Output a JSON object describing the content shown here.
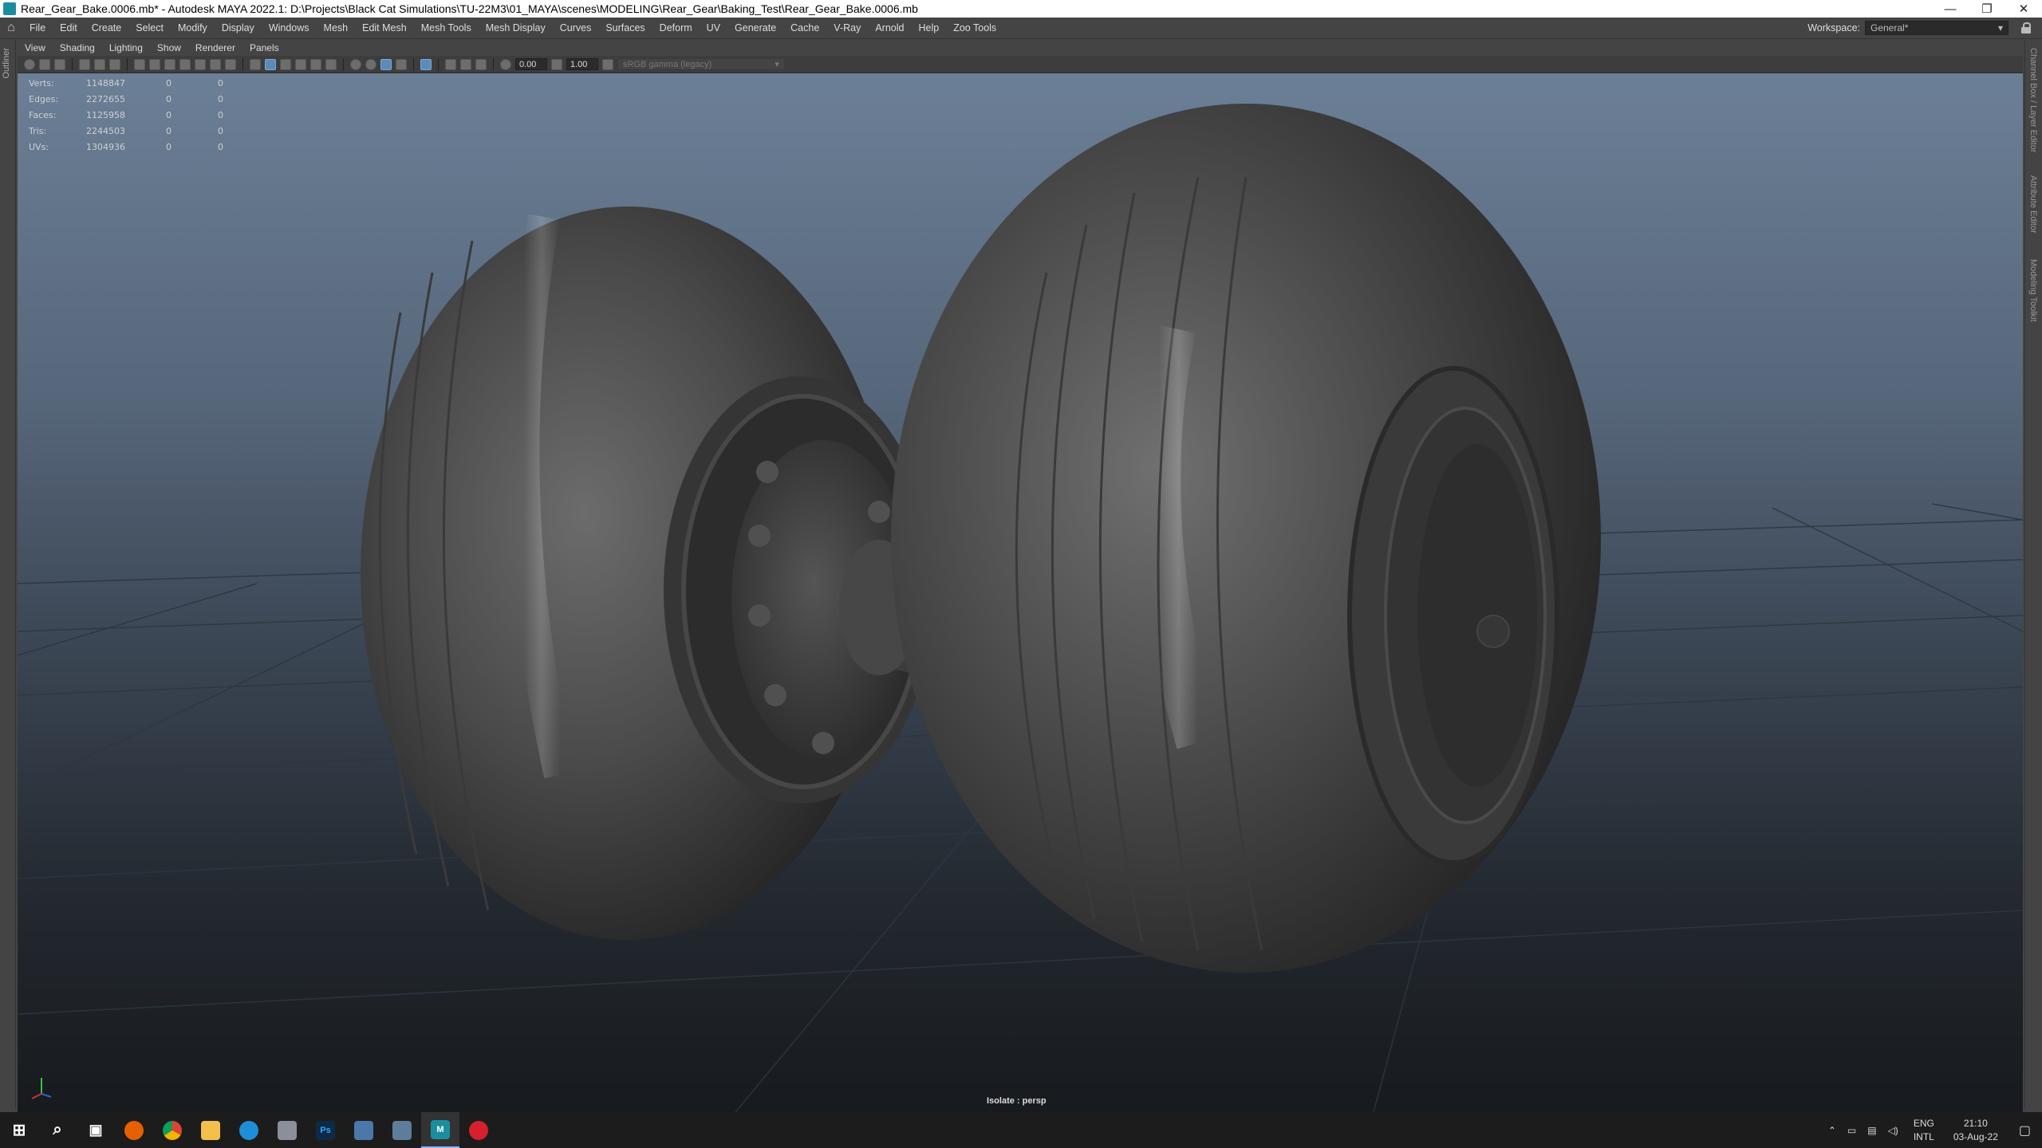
{
  "window": {
    "title": "Rear_Gear_Bake.0006.mb* - Autodesk MAYA 2022.1: D:\\Projects\\Black Cat Simulations\\TU-22M3\\01_MAYA\\scenes\\MODELING\\Rear_Gear\\Baking_Test\\Rear_Gear_Bake.0006.mb",
    "minimize": "—",
    "restore": "❐",
    "close": "✕"
  },
  "menubar": {
    "items": [
      "File",
      "Edit",
      "Create",
      "Select",
      "Modify",
      "Display",
      "Windows",
      "Mesh",
      "Edit Mesh",
      "Mesh Tools",
      "Mesh Display",
      "Curves",
      "Surfaces",
      "Deform",
      "UV",
      "Generate",
      "Cache",
      "V-Ray",
      "Arnold",
      "Help",
      "Zoo Tools"
    ],
    "workspace_label": "Workspace:",
    "workspace_value": "General*"
  },
  "left_tabs": {
    "outliner": "Outliner"
  },
  "right_tabs": [
    "Channel Box / Layer Editor",
    "Attribute Editor",
    "Modeling Toolkit"
  ],
  "panel_menu": [
    "View",
    "Shading",
    "Lighting",
    "Show",
    "Renderer",
    "Panels"
  ],
  "panel_toolbar": {
    "value_a": "0.00",
    "value_b": "1.00",
    "color_space": "sRGB gamma (legacy)"
  },
  "hud": {
    "rows": [
      {
        "label": "Verts:",
        "total": "1148847",
        "selected": "0",
        "third": "0"
      },
      {
        "label": "Edges:",
        "total": "2272655",
        "selected": "0",
        "third": "0"
      },
      {
        "label": "Faces:",
        "total": "1125958",
        "selected": "0",
        "third": "0"
      },
      {
        "label": "Tris:",
        "total": "2244503",
        "selected": "0",
        "third": "0"
      },
      {
        "label": "UVs:",
        "total": "1304936",
        "selected": "0",
        "third": "0"
      }
    ]
  },
  "viewport": {
    "camera_label": "Isolate : persp"
  },
  "taskbar": {
    "apps": [
      {
        "name": "start-icon",
        "glyph": "⊞",
        "color": "#1c1c1c"
      },
      {
        "name": "search-icon",
        "glyph": "⌕",
        "color": "#1c1c1c"
      },
      {
        "name": "task-view-icon",
        "glyph": "▣",
        "color": "#1c1c1c"
      },
      {
        "name": "firefox-icon",
        "glyph": "",
        "color": "#e66000"
      },
      {
        "name": "chrome-icon",
        "glyph": "",
        "color": "#db4437"
      },
      {
        "name": "file-explorer-icon",
        "glyph": "",
        "color": "#f2c04b"
      },
      {
        "name": "edge-icon",
        "glyph": "",
        "color": "#1e8fd6"
      },
      {
        "name": "cloud-app-icon",
        "glyph": "",
        "color": "#8a8f99"
      },
      {
        "name": "photoshop-icon",
        "glyph": "Ps",
        "color": "#0d2a47"
      },
      {
        "name": "window-app-icon",
        "glyph": "",
        "color": "#4a78a8"
      },
      {
        "name": "notepad-icon",
        "glyph": "",
        "color": "#5d7d9a"
      },
      {
        "name": "maya-icon",
        "glyph": "M",
        "color": "#1b8e9e"
      },
      {
        "name": "record-app-icon",
        "glyph": "",
        "color": "#d6202e"
      }
    ],
    "language_top": "ENG",
    "language_bottom": "INTL",
    "time": "21:10",
    "date": "03-Aug-22"
  }
}
